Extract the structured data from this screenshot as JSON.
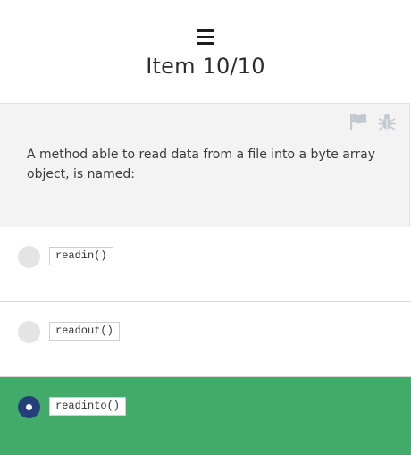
{
  "header": {
    "menu_icon": "hamburger-menu-icon",
    "title": "Item 10/10"
  },
  "question": {
    "text": "A method able to read data from a file into a byte array object, is named:",
    "tools": [
      {
        "icon": "flag-icon",
        "color": "#c3c9d1"
      },
      {
        "icon": "bug-icon",
        "color": "#c3c9d1"
      }
    ],
    "background": "#f3f3f3"
  },
  "options": [
    {
      "label": "readin()",
      "selected": false
    },
    {
      "label": "readout()",
      "selected": false
    },
    {
      "label": "readinto()",
      "selected": true
    }
  ],
  "colors": {
    "selected_background": "#42ab6a",
    "selected_radio": "#233f7a",
    "unselected_radio": "#e4e4e4"
  }
}
